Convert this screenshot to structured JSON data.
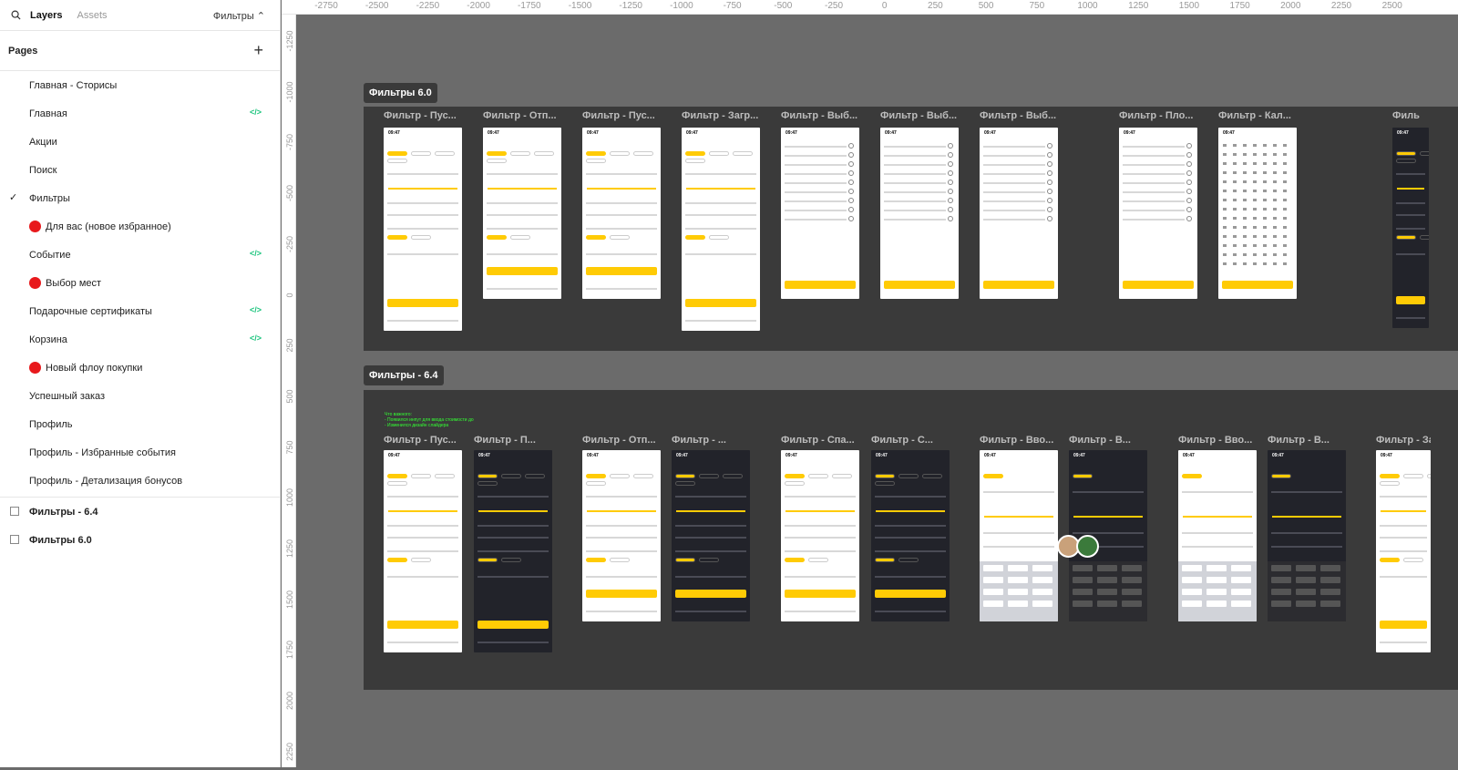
{
  "topbar": {
    "layers": "Layers",
    "assets": "Assets",
    "filter": "Фильтры ⌃"
  },
  "pages": {
    "title": "Pages",
    "items": [
      {
        "label": "Главная - Сторисы",
        "code": ""
      },
      {
        "label": "Главная",
        "code": "</>"
      },
      {
        "label": "Акции",
        "code": ""
      },
      {
        "label": "Поиск",
        "code": ""
      },
      {
        "label": "Фильтры",
        "code": "",
        "checked": true
      },
      {
        "label": "Для вас (новое избранное)",
        "code": "",
        "dot": true
      },
      {
        "label": "Событие",
        "code": "</>"
      },
      {
        "label": "Выбор мест",
        "code": "",
        "dot": true
      },
      {
        "label": "Подарочные сертификаты",
        "code": "</>"
      },
      {
        "label": "Корзина",
        "code": "</>"
      },
      {
        "label": "Новый флоу покупки",
        "code": "",
        "dot": true
      },
      {
        "label": "Успешный заказ",
        "code": ""
      },
      {
        "label": "Профиль",
        "code": ""
      },
      {
        "label": "Профиль - Избранные события",
        "code": ""
      },
      {
        "label": "Профиль - Детализация бонусов",
        "code": ""
      }
    ]
  },
  "layers": [
    {
      "label": "Фильтры - 6.4"
    },
    {
      "label": "Фильтры 6.0"
    }
  ],
  "ruler": {
    "top": [
      "-2750",
      "-2500",
      "-2250",
      "-2000",
      "-1750",
      "-1500",
      "-1250",
      "-1000",
      "-750",
      "-500",
      "-250",
      "0",
      "250",
      "500",
      "750",
      "1000",
      "1250",
      "1500",
      "1750",
      "2000",
      "2250",
      "2500"
    ],
    "left": [
      "-1250",
      "-1000",
      "-750",
      "-500",
      "-250",
      "0",
      "250",
      "500",
      "750",
      "1000",
      "1250",
      "1500",
      "1750",
      "2000",
      "2250"
    ]
  },
  "canvas": {
    "section1": {
      "title": "Фильтры 6.0"
    },
    "section2": {
      "title": "Фильтры - 6.4"
    },
    "frames1": [
      "Фильтр - Пус...",
      "Фильтр - Отп...",
      "Фильтр - Пус...",
      "Фильтр - Загр...",
      "Фильтр - Выб...",
      "Фильтр - Выб...",
      "Фильтр - Выб...",
      "Фильтр - Пло...",
      "Фильтр - Кал...",
      "Филь"
    ],
    "frames2": [
      "Фильтр - Пус...",
      "Фильтр - П...",
      "Фильтр - Отп...",
      "Фильтр - ...",
      "Фильтр - Спа...",
      "Фильтр - С...",
      "Фильтр - Вво...",
      "Фильтр - В...",
      "Фильтр - Вво...",
      "Фильтр - В...",
      "Фильтр - За"
    ],
    "note": "Что важного:\n- Появился инпут для ввода стоимости до\n- Изменился дизайн слайдера",
    "phone_time": "09:47"
  },
  "colors": {
    "accent": "#ffcb05",
    "section": "#3a3a3a",
    "canvas": "#6b6b6b",
    "code": "#1bc47d",
    "dot": "#e8191c"
  }
}
